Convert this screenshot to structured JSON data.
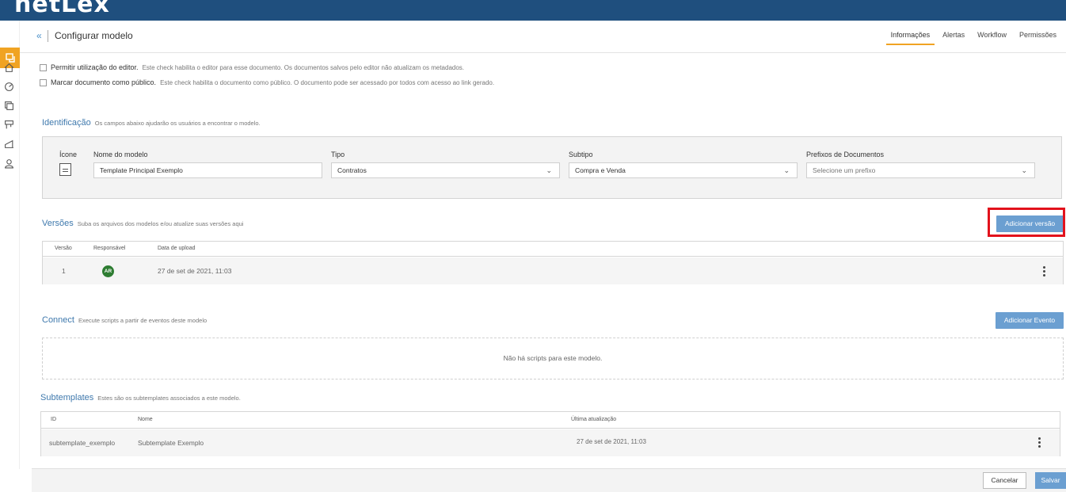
{
  "brand": {
    "logo_text": "netLex"
  },
  "header": {
    "back_label": "«",
    "title": "Configurar modelo",
    "tabs": [
      {
        "label": "Informações",
        "active": true
      },
      {
        "label": "Alertas"
      },
      {
        "label": "Workflow"
      },
      {
        "label": "Permissões"
      }
    ]
  },
  "sidebar": {
    "icons": [
      "model-icon",
      "home-icon",
      "dashboard-icon",
      "documents-icon",
      "board-icon",
      "chart-icon",
      "user-icon"
    ]
  },
  "options": [
    {
      "label": "Permitir utilização do editor.",
      "help": "Este check habilita o editor para esse documento. Os documentos salvos pelo editor não atualizam os metadados.",
      "checked": false
    },
    {
      "label": "Marcar documento como público.",
      "help": "Este check habilita o documento como público. O documento pode ser acessado por todos com acesso ao link gerado.",
      "checked": false
    }
  ],
  "identificacao": {
    "title": "Identificação",
    "help": "Os campos abaixo ajudarão os usuários a encontrar o modelo.",
    "icone_label": "Ícone",
    "nome_label": "Nome do modelo",
    "nome_value": "Template Principal Exemplo",
    "tipo_label": "Tipo",
    "tipo_value": "Contratos",
    "subtipo_label": "Subtipo",
    "subtipo_value": "Compra e Venda",
    "prefixos_label": "Prefixos de Documentos",
    "prefixos_placeholder": "Selecione um prefixo"
  },
  "versoes": {
    "title": "Versões",
    "help": "Suba os arquivos dos modelos e/ou atualize suas versões aqui",
    "add_button": "Adicionar versão",
    "columns": [
      "Versão",
      "Responsável",
      "Data de upload"
    ],
    "rows": [
      {
        "versao": "1",
        "responsavel": "AR",
        "data": "27 de set de 2021, 11:03"
      }
    ]
  },
  "connect": {
    "title": "Connect",
    "help": "Execute scripts a partir de eventos deste modelo",
    "add_button": "Adicionar Evento",
    "empty_text": "Não há scripts para este modelo."
  },
  "subtemplates": {
    "title": "Subtemplates",
    "help": "Estes são os subtemplates associados a este modelo.",
    "columns": [
      "ID",
      "Nome",
      "Última atualização"
    ],
    "rows": [
      {
        "id": "subtemplate_exemplo",
        "nome": "Subtemplate Exemplo",
        "atualizacao": "27 de set de 2021, 11:03"
      }
    ]
  },
  "footer": {
    "cancel": "Cancelar",
    "save": "Salvar"
  },
  "colors": {
    "brand_bar": "#1f4f7e",
    "accent": "#f0a323",
    "primary_button": "#6b9fd1",
    "section_title": "#3f79ad",
    "highlight": "#e2121c"
  }
}
